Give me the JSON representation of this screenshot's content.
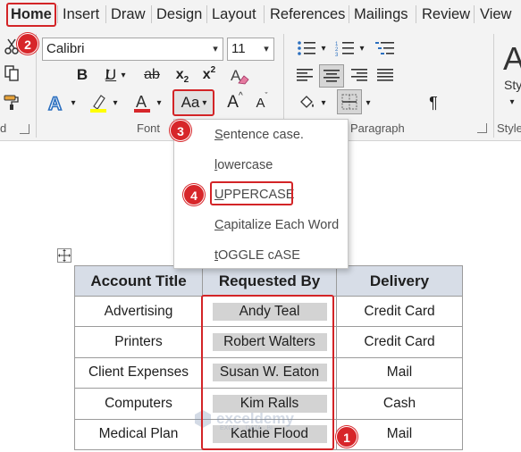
{
  "tabs": [
    "Home",
    "Insert",
    "Draw",
    "Design",
    "Layout",
    "References",
    "Mailings",
    "Review",
    "View"
  ],
  "font": {
    "name": "Calibri",
    "size": "11"
  },
  "font_buttons": {
    "bold": "B",
    "italic": "I",
    "underline": "U",
    "strikethrough": "ab",
    "subscript": "x",
    "subscript_mark": "2",
    "superscript": "x",
    "superscript_mark": "2",
    "change_case": "Aa",
    "grow": "A",
    "shrink": "A",
    "font_color": "A",
    "text_effects": "A",
    "clear_format": "A",
    "styles": "A"
  },
  "groups": {
    "font": "Font",
    "paragraph": "Paragraph",
    "styles": "Style",
    "clipboard": "d"
  },
  "styles_label": "Sty",
  "paragraph_mark": "¶",
  "case_menu": [
    {
      "label": "Sentence case.",
      "key": "S",
      "rest": "entence case."
    },
    {
      "label": "lowercase",
      "key": "l",
      "rest": "owercase"
    },
    {
      "label": "UPPERCASE",
      "key": "U",
      "rest": "PPERCASE"
    },
    {
      "label": "Capitalize Each Word",
      "key": "C",
      "rest": "apitalize Each Word"
    },
    {
      "label": "tOGGLE cASE",
      "key": "t",
      "rest": "OGGLE cASE"
    }
  ],
  "table": {
    "headers": [
      "Account Title",
      "Requested By",
      "Delivery"
    ],
    "rows": [
      [
        "Advertising",
        "Andy Teal",
        "Credit Card"
      ],
      [
        "Printers",
        "Robert Walters",
        "Credit Card"
      ],
      [
        "Client Expenses",
        "Susan W. Eaton",
        "Mail"
      ],
      [
        "Computers",
        "Kim Ralls",
        "Cash"
      ],
      [
        "Medical Plan",
        "Kathie Flood",
        "Mail"
      ]
    ]
  },
  "badges": [
    "1",
    "2",
    "3",
    "4"
  ],
  "watermark": {
    "brand": "exceldemy",
    "tagline": "EXCEL · DATA · BI"
  },
  "colors": {
    "red_annotation": "#d32427",
    "table_header": "#d7dde7",
    "highlight": "#d3d3d3",
    "font_color_bar": "#d7262a",
    "highlight_bar": "#ffff00"
  }
}
